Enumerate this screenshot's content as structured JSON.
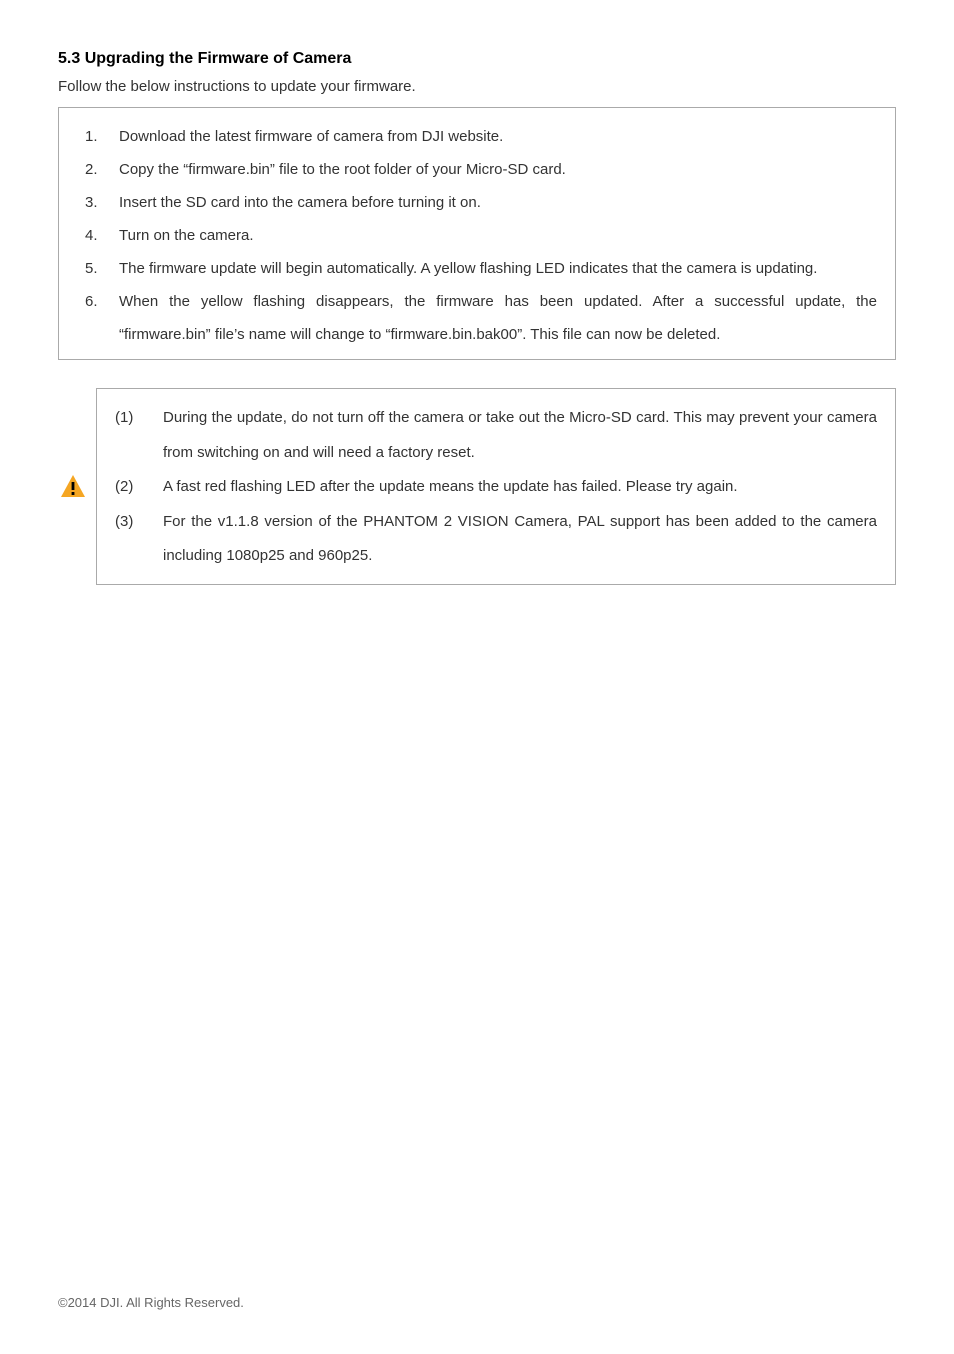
{
  "heading": "5.3 Upgrading the Firmware of Camera",
  "intro": "Follow the below instructions to update your firmware.",
  "steps": [
    {
      "num": "1.",
      "text": "Download the latest firmware of camera from DJI website."
    },
    {
      "num": "2.",
      "text": "Copy the “firmware.bin” file to the root folder of your Micro-SD card."
    },
    {
      "num": "3.",
      "text": "Insert the SD card into the camera before turning it on."
    },
    {
      "num": "4.",
      "text": "Turn on the camera."
    },
    {
      "num": "5.",
      "text": "The firmware update will begin automatically. A yellow flashing LED indicates that the camera is updating."
    },
    {
      "num": "6.",
      "text": "When the yellow flashing disappears, the firmware has been updated. After a successful update, the “firmware.bin” file’s name will change to “firmware.bin.bak00”. This file can now be deleted.",
      "justify": true
    }
  ],
  "warnings": [
    {
      "num": "(1)",
      "text": "During the update, do not turn off the camera or take out the Micro-SD card. This may prevent your camera from switching on and will need a factory reset.",
      "justify": true
    },
    {
      "num": "(2)",
      "text": "A fast red flashing LED after the update means the update has failed. Please try again."
    },
    {
      "num": "(3)",
      "text": "For the v1.1.8 version of the PHANTOM 2 VISION Camera, PAL support has been added to the camera including 1080p25 and 960p25.",
      "justify": true
    }
  ],
  "footer": "©2014 DJI. All Rights Reserved."
}
